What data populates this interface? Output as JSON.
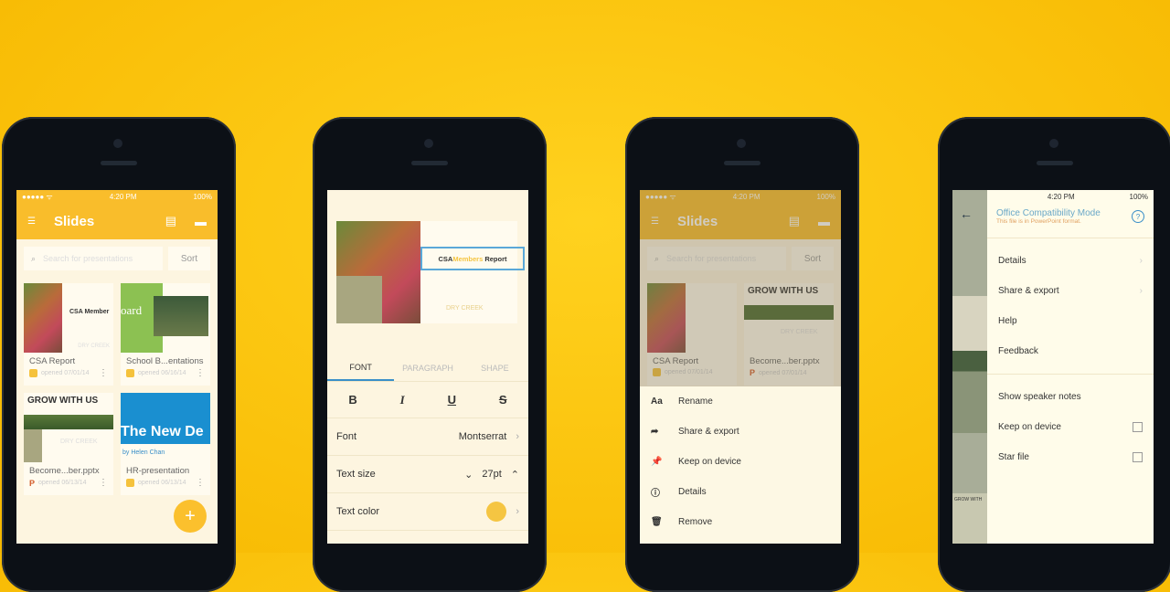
{
  "colors": {
    "background": "#fcc310",
    "accent": "#f9bd2b",
    "tab_underline": "#3a8fc8"
  },
  "status": {
    "time": "4:20 PM",
    "battery": "100%"
  },
  "phone1": {
    "title": "Slides",
    "search_placeholder": "Search for presentations",
    "sort": "Sort",
    "files": [
      {
        "name": "CSA Report",
        "meta": "opened 07/01/14",
        "type": "slides",
        "thumb_title": "CSA Member",
        "thumb_sub": "DRY CREEK"
      },
      {
        "name": "School B...entations",
        "meta": "opened 06/16/14",
        "type": "slides",
        "thumb_title": "oard"
      },
      {
        "name": "Become...ber.pptx",
        "meta": "opened 06/13/14",
        "type": "pptx",
        "thumb_title": "GROW WITH US",
        "thumb_sub": "DRY CREEK"
      },
      {
        "name": "HR-presentation",
        "meta": "opened 06/13/14",
        "type": "slides",
        "thumb_title": "The New De",
        "thumb_sub": "by Helen Chan"
      }
    ],
    "fab": "+"
  },
  "phone2": {
    "slide_title_a": "CSA ",
    "slide_title_b": "Members",
    "slide_title_c": " Report",
    "slide_footer": "DRY CREEK",
    "tabs": [
      "FONT",
      "PARAGRAPH",
      "SHAPE"
    ],
    "format": [
      "B",
      "I",
      "U",
      "S"
    ],
    "font_label": "Font",
    "font_value": "Montserrat",
    "size_label": "Text size",
    "size_value": "27pt",
    "color_label": "Text color",
    "text_color": "#f5c542"
  },
  "phone3": {
    "title": "Slides",
    "search_placeholder": "Search for presentations",
    "sort": "Sort",
    "files": [
      {
        "name": "CSA Report",
        "meta": "opened 07/01/14"
      },
      {
        "name": "Become...ber.pptx",
        "meta": "opened 07/01/14",
        "thumb_title": "GROW WITH US",
        "thumb_sub": "DRY CREEK"
      }
    ],
    "sheet": [
      {
        "icon": "Aa",
        "label": "Rename"
      },
      {
        "icon": "➦",
        "label": "Share & export"
      },
      {
        "icon": "📌",
        "label": "Keep on device"
      },
      {
        "icon": "ⓘ",
        "label": "Details"
      },
      {
        "icon": "🗑",
        "label": "Remove"
      }
    ]
  },
  "phone4": {
    "mode_title": "Office Compatibility Mode",
    "mode_sub": "This file is in PowerPoint format.",
    "menu": [
      "Details",
      "Share & export",
      "Help",
      "Feedback"
    ],
    "options": [
      "Show speaker notes",
      "Keep on device",
      "Star file"
    ],
    "thumb_title": "GROW WITH"
  }
}
